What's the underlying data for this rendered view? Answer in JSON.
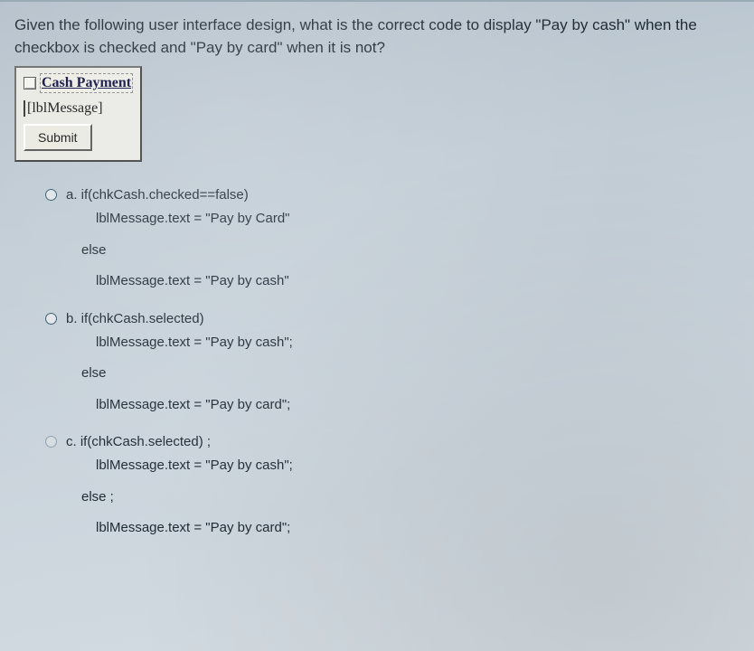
{
  "question": "Given the following user interface design, what is the correct code to display \"Pay by cash\" when the checkbox is checked and \"Pay by card\" when it is not?",
  "ui": {
    "checkbox_label": "Cash Payment",
    "message_label": "[lblMessage]",
    "submit_label": "Submit"
  },
  "options": {
    "a": {
      "head": "a. if(chkCash.checked==false)",
      "l1": "lblMessage.text = \"Pay by Card\"",
      "else": "else",
      "l2": "lblMessage.text = \"Pay by cash\""
    },
    "b": {
      "head": "b. if(chkCash.selected)",
      "l1": "lblMessage.text = \"Pay by cash\";",
      "else": "else",
      "l2": "lblMessage.text = \"Pay by card\";"
    },
    "c": {
      "head": "c. if(chkCash.selected) ;",
      "l1": "lblMessage.text = \"Pay by cash\";",
      "else": "else ;",
      "l2": "lblMessage.text = \"Pay by card\";"
    }
  }
}
